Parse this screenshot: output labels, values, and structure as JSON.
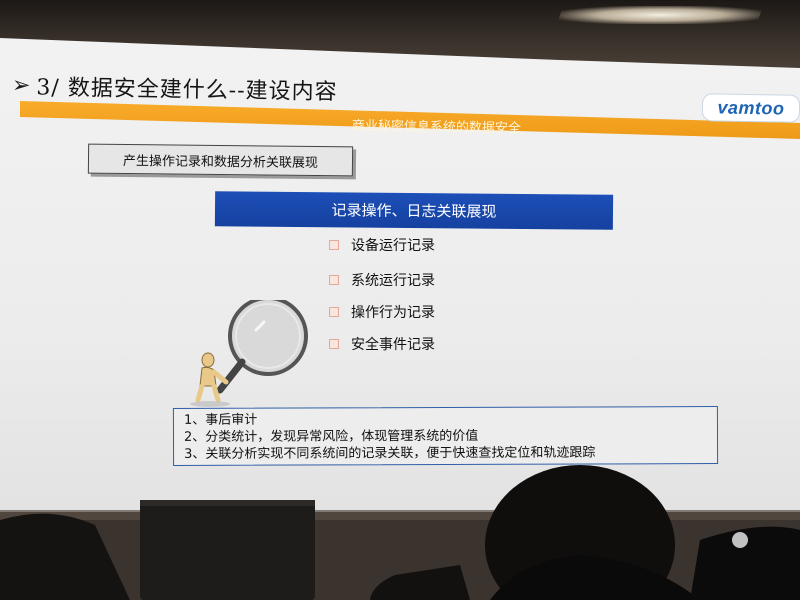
{
  "slide": {
    "title_arrow": "➢",
    "title": "3/ 数据安全建什么--建设内容",
    "header_bar": "商业秘密信息系统的数据安全",
    "logo": "vamtoo",
    "subtitle": "产生操作记录和数据分析关联展现",
    "blue_bar": "记录操作、日志关联展现",
    "bullets": [
      "设备运行记录",
      "系统运行记录",
      "操作行为记录",
      "安全事件记录"
    ],
    "notes": [
      "1、事后审计",
      "2、分类统计，发现异常风险，体现管理系统的价值",
      "3、关联分析实现不同系统间的记录关联，便于快速查找定位和轨迹跟踪"
    ]
  },
  "colors": {
    "orange_bar": "#f2a11f",
    "blue_bar": "#1a48ad",
    "logo_blue": "#1d64b4",
    "notes_border": "#2f5fa8"
  },
  "icons": {
    "title_arrow": "arrow-bullet-icon",
    "bullet": "checkbox-bullet-icon",
    "figure": "figure-with-magnifier-icon"
  }
}
